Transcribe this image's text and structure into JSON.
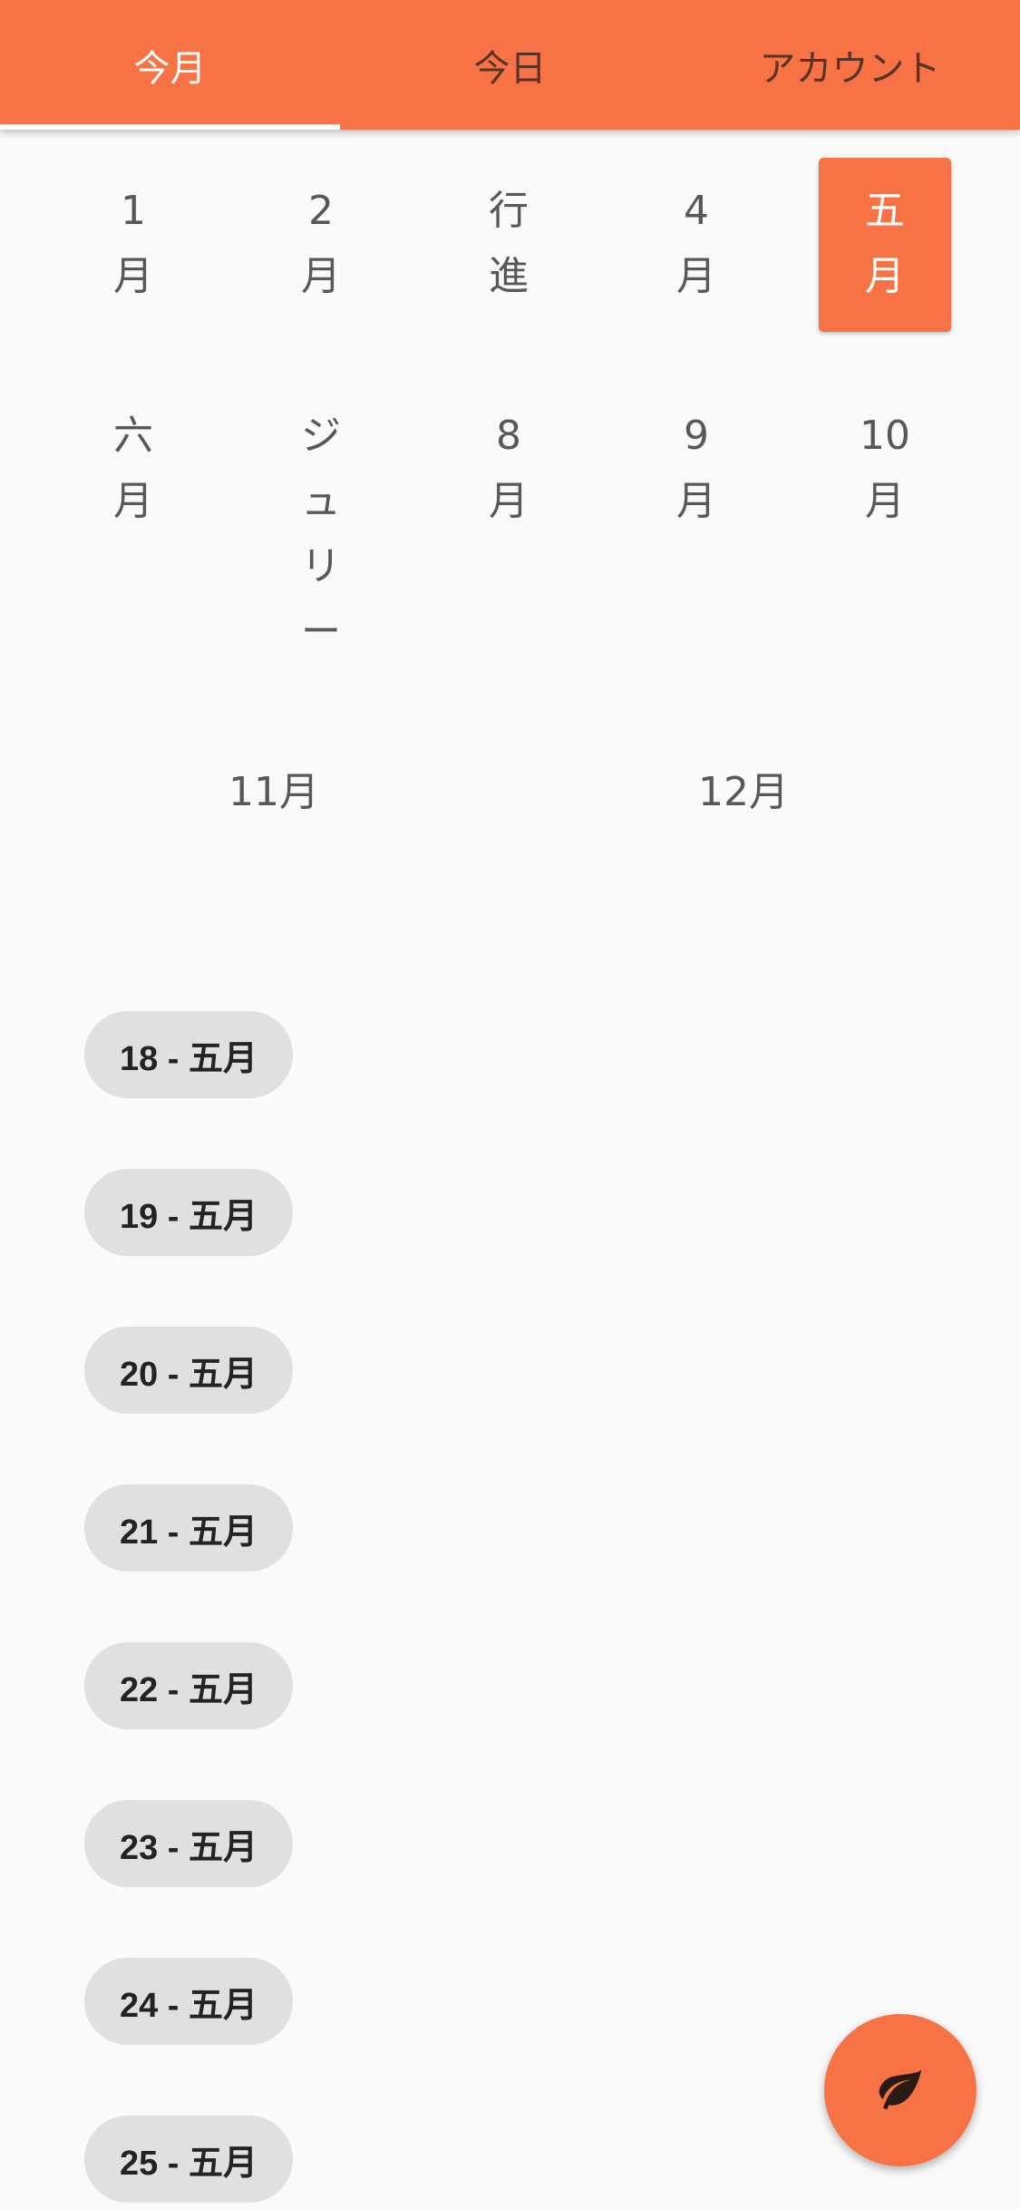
{
  "tabs": [
    {
      "label": "今月",
      "active": true
    },
    {
      "label": "今日",
      "active": false
    },
    {
      "label": "アカウント",
      "active": false
    }
  ],
  "months": [
    {
      "chars": [
        "1",
        "月"
      ]
    },
    {
      "chars": [
        "2",
        "月"
      ]
    },
    {
      "chars": [
        "行",
        "進"
      ]
    },
    {
      "chars": [
        "4",
        "月"
      ]
    },
    {
      "chars": [
        "五",
        "月"
      ],
      "selected": true
    },
    {
      "chars": [
        "六",
        "月"
      ]
    },
    {
      "chars": [
        "ジ",
        "ュ",
        "リ",
        "ー"
      ]
    },
    {
      "chars": [
        "8",
        "月"
      ]
    },
    {
      "chars": [
        "9",
        "月"
      ]
    },
    {
      "chars": [
        "10",
        "月"
      ]
    },
    {
      "label": "11月"
    },
    {
      "label": "12月"
    }
  ],
  "dates": [
    "18 - 五月",
    "19 - 五月",
    "20 - 五月",
    "21 - 五月",
    "22 - 五月",
    "23 - 五月",
    "24 - 五月",
    "25 - 五月"
  ],
  "fab": {
    "icon": "leaf-icon"
  },
  "colors": {
    "accent": "#f77244",
    "background": "#fafafa",
    "chip": "#e0e0e0"
  }
}
